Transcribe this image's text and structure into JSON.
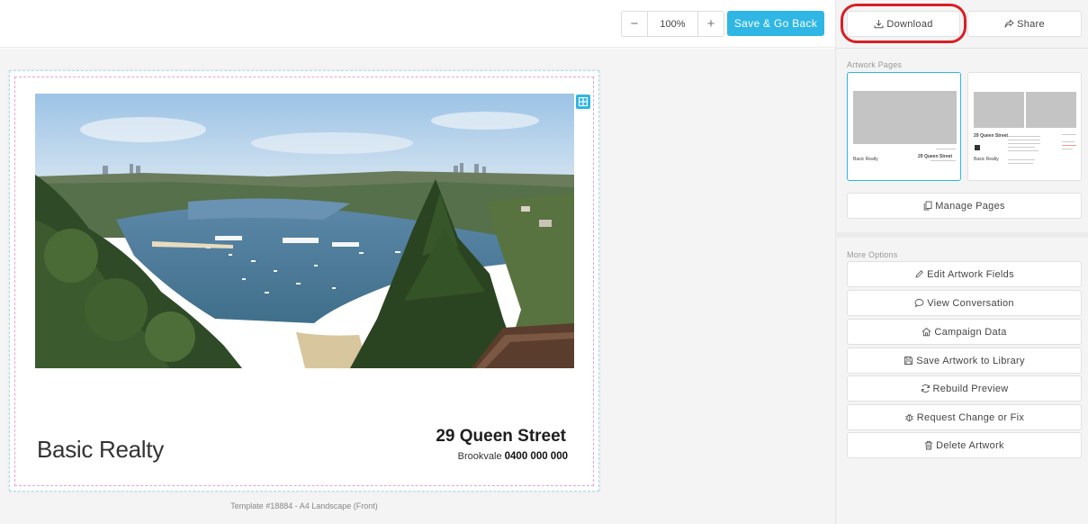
{
  "toolbar": {
    "zoom_minus": "−",
    "zoom_value": "100%",
    "zoom_plus": "+",
    "save_back_label": "Save & Go Back"
  },
  "artwork": {
    "brand_name": "Basic Realty",
    "address": "29 Queen Street",
    "suburb": "Brookvale",
    "phone": "0400 000 000",
    "caption": "Template #18884 - A4 Landscape (Front)"
  },
  "panel": {
    "download_label": "Download",
    "share_label": "Share",
    "artwork_pages_label": "Artwork Pages",
    "manage_pages_label": "Manage Pages",
    "more_options_label": "More Options",
    "options": [
      {
        "label": "Edit Artwork Fields",
        "icon": "pencil-icon"
      },
      {
        "label": "View Conversation",
        "icon": "chat-bubble-icon"
      },
      {
        "label": "Campaign Data",
        "icon": "home-icon"
      },
      {
        "label": "Save Artwork to Library",
        "icon": "floppy-disk-icon"
      },
      {
        "label": "Rebuild Preview",
        "icon": "refresh-icon"
      },
      {
        "label": "Request Change or Fix",
        "icon": "bug-icon"
      },
      {
        "label": "Delete Artwork",
        "icon": "trash-icon"
      }
    ],
    "thumbs": [
      {
        "brand": "Basic Realty",
        "address": "29 Queen Street"
      },
      {
        "brand": "Basic Realty",
        "address": "29 Queen Street"
      }
    ]
  },
  "colors": {
    "accent": "#2fb6e4",
    "highlight_ring": "#d81f26",
    "panel_bg": "#f4f4f4"
  }
}
